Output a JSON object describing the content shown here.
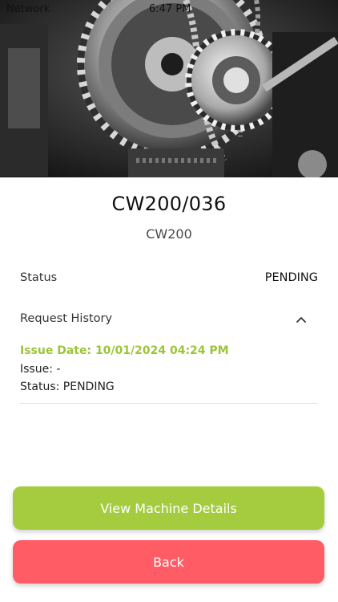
{
  "statusbar": {
    "network": "Network",
    "time": "6:47 PM"
  },
  "machine": {
    "code": "CW200/036",
    "model": "CW200"
  },
  "status": {
    "label": "Status",
    "value": "PENDING"
  },
  "history": {
    "label": "Request History",
    "toggle_icon": "chevron-up-icon",
    "entries": [
      {
        "issue_date": "Issue Date: 10/01/2024 04:24 PM",
        "issue": "Issue: -",
        "status": "Status: PENDING"
      }
    ]
  },
  "buttons": {
    "view_details": "View Machine Details",
    "back": "Back"
  },
  "colors": {
    "accent_green": "#a4cc3e",
    "issue_date_green": "#9cc43a",
    "back_red": "#ff5c66"
  }
}
